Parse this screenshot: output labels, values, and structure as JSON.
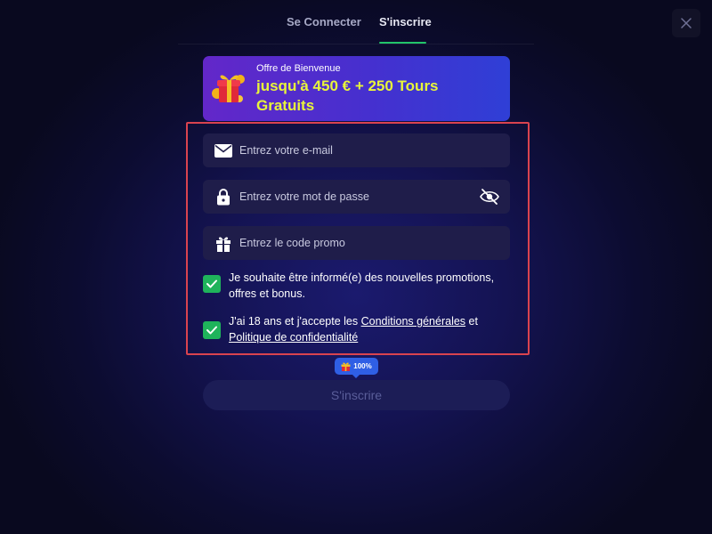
{
  "tabs": {
    "login": "Se Connecter",
    "register": "S'inscrire"
  },
  "banner": {
    "subtitle": "Offre de Bienvenue",
    "title": "jusqu'à 450 € + 250 Tours Gratuits"
  },
  "form": {
    "email_placeholder": "Entrez votre e-mail",
    "password_placeholder": "Entrez votre mot de passe",
    "promo_placeholder": "Entrez le code promo",
    "newsletter_label": "Je souhaite être informé(e) des nouvelles promotions, offres et bonus.",
    "terms": {
      "prefix": "J'ai 18 ans et j'accepte les ",
      "terms_link": "Conditions générales",
      "middle": " et",
      "privacy_link": "Politique de confidentialité"
    }
  },
  "progress": "100%",
  "submit_label": "S'inscrire",
  "colors": {
    "accent_green": "#1fb35b",
    "banner_text": "#e8f53a",
    "highlight": "#d9434f"
  },
  "icons": [
    "close-icon",
    "gift-icon",
    "envelope-icon",
    "lock-icon",
    "eye-slash-icon",
    "checkmark-icon"
  ]
}
